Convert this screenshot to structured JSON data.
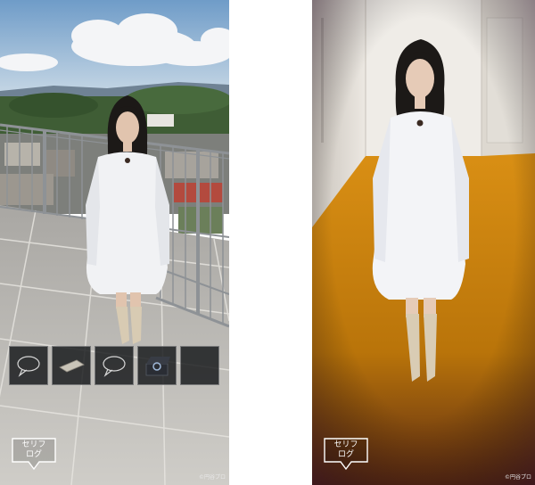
{
  "screens": [
    {
      "id": "rooftop",
      "inventory": [
        {
          "icon": "speech-bubble-icon"
        },
        {
          "icon": "card-icon"
        },
        {
          "icon": "speech-bubble-icon"
        },
        {
          "icon": "ring-box-icon"
        },
        {
          "icon": "empty-slot"
        }
      ],
      "log_button_label": "セリフ\nログ",
      "copyright": "©円谷プロ"
    },
    {
      "id": "hallway",
      "log_button_label": "セリフ\nログ",
      "copyright": "©円谷プロ"
    }
  ],
  "colors": {
    "sky": "#8fb3d6",
    "cloud": "#f2f4f6",
    "forest": "#3e5b34",
    "tiles": "#b9b7b2",
    "railing": "#8a8d90",
    "hall_floor": "#d9920f",
    "hall_wall": "#e6e3dc",
    "dress": "#f2f3f5",
    "hair": "#1b1816",
    "boots": "#d9ccb4"
  }
}
